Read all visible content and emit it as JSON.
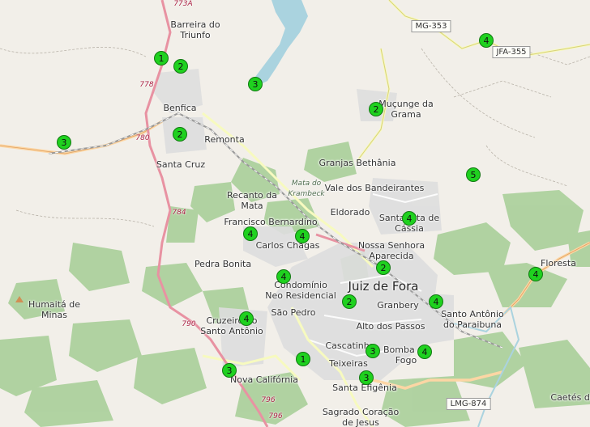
{
  "places": [
    {
      "id": "barreira",
      "text": "Barreira do\nTriunfo"
    },
    {
      "id": "benfica",
      "text": "Benfica"
    },
    {
      "id": "remonta",
      "text": "Remonta"
    },
    {
      "id": "santacruz",
      "text": "Santa Cruz"
    },
    {
      "id": "mucunge",
      "text": "Muçunge da\nGrama"
    },
    {
      "id": "granjas",
      "text": "Granjas Bethânia"
    },
    {
      "id": "vale",
      "text": "Vale dos Bandeirantes"
    },
    {
      "id": "eldorado",
      "text": "Eldorado"
    },
    {
      "id": "santacassia",
      "text": "Santa Rita de\nCássia"
    },
    {
      "id": "nossa",
      "text": "Nossa Senhora\nAparecida"
    },
    {
      "id": "recanto",
      "text": "Recanto da\nMata"
    },
    {
      "id": "francisco",
      "text": "Francisco Bernardino"
    },
    {
      "id": "carlos",
      "text": "Carlos Chagas"
    },
    {
      "id": "pedrabonita",
      "text": "Pedra Bonita"
    },
    {
      "id": "condominio",
      "text": "Condomínio\nNeo Residencial"
    },
    {
      "id": "saopedro",
      "text": "São Pedro"
    },
    {
      "id": "juizdefora",
      "text": "Juiz de Fora"
    },
    {
      "id": "granbery",
      "text": "Granbery"
    },
    {
      "id": "santoantonio_p",
      "text": "Santo Antônio\ndo Paraibuna"
    },
    {
      "id": "floresta",
      "text": "Floresta"
    },
    {
      "id": "altopassos",
      "text": "Alto dos Passos"
    },
    {
      "id": "cascatinha",
      "text": "Cascatinha"
    },
    {
      "id": "bomba",
      "text": "Bomba de\nFogo"
    },
    {
      "id": "teixeiras",
      "text": "Teixeiras"
    },
    {
      "id": "santaefigenia",
      "text": "Santa Efigênia"
    },
    {
      "id": "sagrado",
      "text": "Sagrado Coração\nde Jesus"
    },
    {
      "id": "cruzeiro",
      "text": "Cruzeiro do\nSanto Antônio"
    },
    {
      "id": "novacal",
      "text": "Nova Califórnia"
    },
    {
      "id": "humaita",
      "text": "Humaitá de\nMinas"
    },
    {
      "id": "caetes",
      "text": "Caetés do"
    },
    {
      "id": "mata",
      "text": "Mata do\nKrambeck"
    }
  ],
  "road_numbers": [
    "773A",
    "778",
    "780",
    "784",
    "790",
    "796",
    "796"
  ],
  "shields": [
    "MG-353",
    "JFA-355",
    "LMG-874"
  ],
  "markers": [
    "1",
    "2",
    "3",
    "2",
    "3",
    "2",
    "4",
    "4",
    "5",
    "4",
    "4",
    "4",
    "2",
    "4",
    "4",
    "2",
    "3",
    "4",
    "4",
    "1",
    "3",
    "3"
  ],
  "colors": {
    "forest": "#add19e",
    "water": "#aad3df",
    "urban": "#dddddd",
    "marker": "#1fd11f",
    "primary": "#fcd6a4",
    "motorway": "#e892a2"
  }
}
